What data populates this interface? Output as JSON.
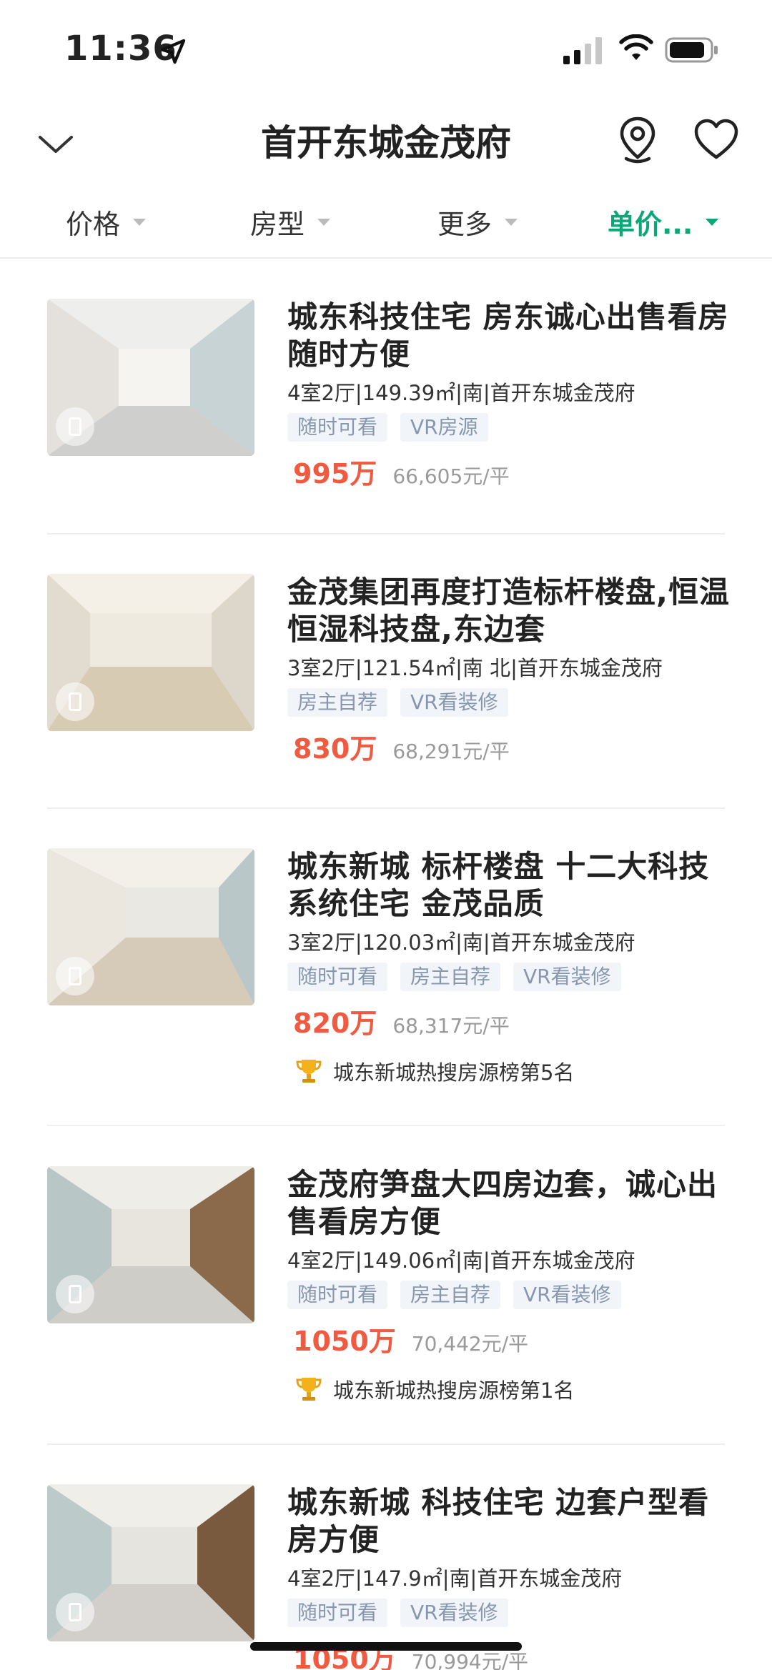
{
  "status_bar": {
    "time": "11:36"
  },
  "nav": {
    "title": "首开东城金茂府"
  },
  "filters": [
    {
      "label": "价格",
      "active": false
    },
    {
      "label": "房型",
      "active": false
    },
    {
      "label": "更多",
      "active": false
    },
    {
      "label": "单价...",
      "active": true
    }
  ],
  "colors": {
    "accent_green": "#0da678",
    "price_red": "#ef5a40",
    "tag_text": "#8797b0",
    "tag_bg": "#f1f4f8"
  },
  "listings": [
    {
      "title": "城东科技住宅  房东诚心出售看房随时方便",
      "meta": "4室2厅|149.39㎡|南|首开东城金茂府",
      "tags": [
        "随时可看",
        "VR房源"
      ],
      "price": "995万",
      "unit_price": "66,605元/平",
      "rank": ""
    },
    {
      "title": "金茂集团再度打造标杆楼盘,恒温恒湿科技盘,东边套",
      "meta": "3室2厅|121.54㎡|南 北|首开东城金茂府",
      "tags": [
        "房主自荐",
        "VR看装修"
      ],
      "price": "830万",
      "unit_price": "68,291元/平",
      "rank": ""
    },
    {
      "title": "城东新城 标杆楼盘 十二大科技系统住宅 金茂品质",
      "meta": "3室2厅|120.03㎡|南|首开东城金茂府",
      "tags": [
        "随时可看",
        "房主自荐",
        "VR看装修"
      ],
      "price": "820万",
      "unit_price": "68,317元/平",
      "rank": "城东新城热搜房源榜第5名"
    },
    {
      "title": "金茂府笋盘大四房边套，诚心出售看房方便",
      "meta": "4室2厅|149.06㎡|南|首开东城金茂府",
      "tags": [
        "随时可看",
        "房主自荐",
        "VR看装修"
      ],
      "price": "1050万",
      "unit_price": "70,442元/平",
      "rank": "城东新城热搜房源榜第1名"
    },
    {
      "title": "城东新城 科技住宅 边套户型看房方便",
      "meta": "4室2厅|147.9㎡|南|首开东城金茂府",
      "tags": [
        "随时可看",
        "VR看装修"
      ],
      "price": "1050万",
      "unit_price": "70,994元/平",
      "rank": ""
    }
  ]
}
